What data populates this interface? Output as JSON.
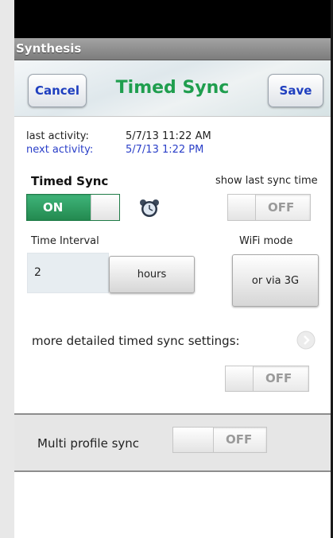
{
  "app": {
    "title": "Synthesis"
  },
  "header": {
    "cancel_label": "Cancel",
    "title": "Timed Sync",
    "save_label": "Save"
  },
  "activity": {
    "last_label": "last activity:",
    "last_value": "5/7/13  11:22 AM",
    "next_label": "next activity:",
    "next_value": "5/7/13  1:22 PM"
  },
  "timed_sync": {
    "label": "Timed Sync",
    "toggle_text": "ON",
    "state": true
  },
  "show_last_sync": {
    "label": "show last sync time",
    "toggle_text": "OFF",
    "state": false
  },
  "time_interval": {
    "label": "Time Interval",
    "value": "2",
    "unit_label": "hours"
  },
  "wifi_mode": {
    "label": "WiFi mode",
    "button_label": "or via 3G"
  },
  "detailed": {
    "label": "more detailed timed sync settings:",
    "toggle_text": "OFF",
    "state": false
  },
  "multi_profile": {
    "label": "Multi profile sync",
    "toggle_text": "OFF",
    "state": false
  },
  "icons": {
    "alarm": "alarm-clock-icon",
    "chevron": "chevron-right-circle-icon"
  },
  "colors": {
    "accent_green": "#1f9e4e",
    "button_blue": "#1f3fbf",
    "next_activity_blue": "#2a3fc8"
  }
}
